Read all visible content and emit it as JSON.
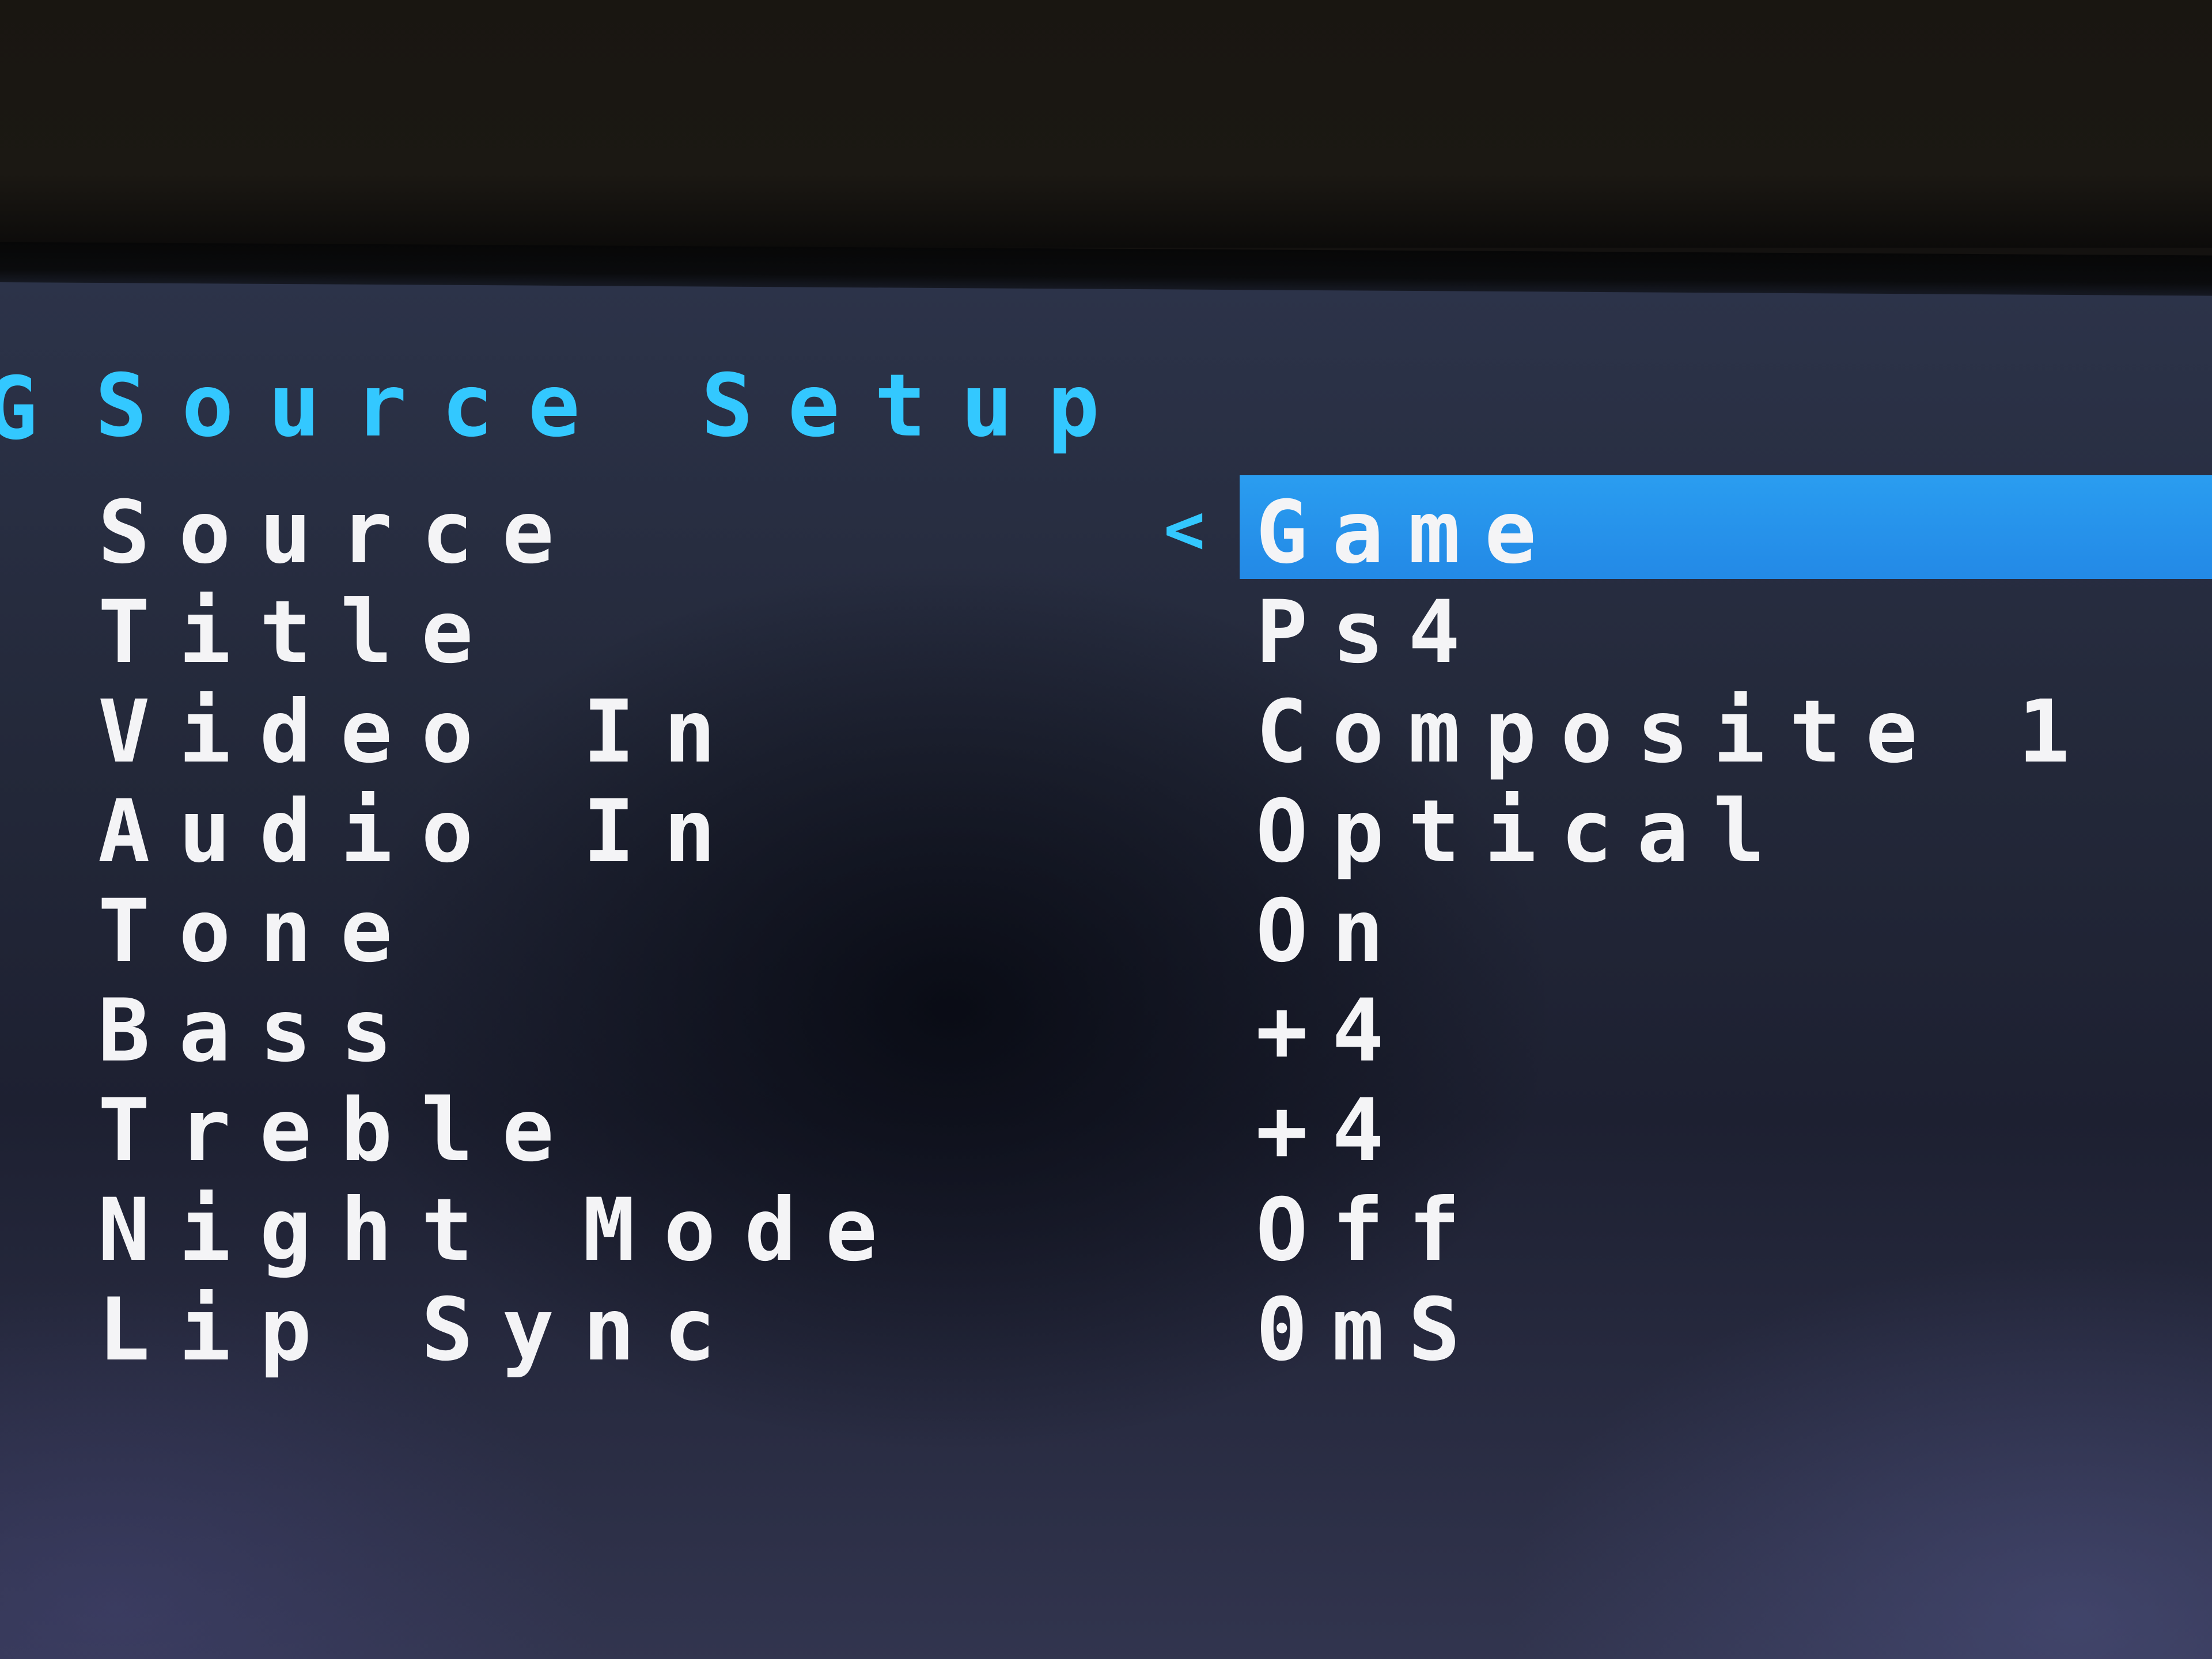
{
  "menu": {
    "title": "Source Setup",
    "selected_prefix_icon": "chevron-left-icon",
    "items": [
      {
        "label": "Source",
        "value": "Game",
        "selected": true
      },
      {
        "label": "Title",
        "value": "Ps4"
      },
      {
        "label": "Video In",
        "value": "Composite 1"
      },
      {
        "label": "Audio In",
        "value": "Optical"
      },
      {
        "label": "Tone",
        "value": "On"
      },
      {
        "label": "Bass",
        "value": "+4"
      },
      {
        "label": "Treble",
        "value": "+4"
      },
      {
        "label": "Night Mode",
        "value": "Off"
      },
      {
        "label": "Lip Sync",
        "value": "0mS"
      }
    ]
  },
  "colors": {
    "title_text": "#33c8ff",
    "selection_bar": "#2389e6",
    "item_text": "#f4f4f6"
  }
}
